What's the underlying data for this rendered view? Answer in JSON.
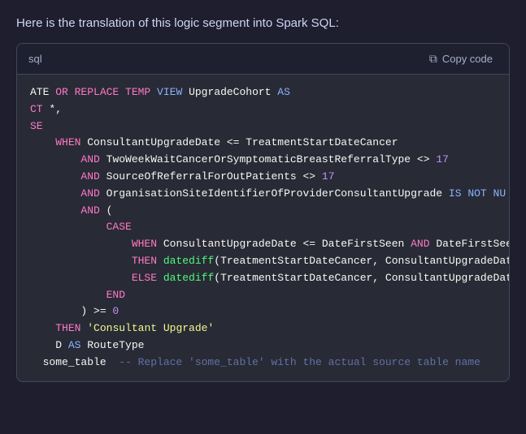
{
  "intro": {
    "text": "Here is the translation of this logic segment into Spark SQL:"
  },
  "code_header": {
    "lang": "sql",
    "copy_label": "Copy code"
  },
  "code_lines": [
    "ATE OR REPLACE TEMP VIEW UpgradeCohort AS",
    "CT *,",
    "SE",
    "    WHEN ConsultantUpgradeDate <= TreatmentStartDateCancer",
    "        AND TwoWeekWaitCancerOrSymptomaticBreastReferralType <> 17",
    "        AND SourceOfReferralForOutPatients <> 17",
    "        AND OrganisationSiteIdentifierOfProviderConsultantUpgrade IS NOT NU",
    "        AND (",
    "            CASE",
    "                WHEN ConsultantUpgradeDate <= DateFirstSeen AND DateFirstSeen I",
    "                THEN datediff(TreatmentStartDateCancer, ConsultantUpgradeDate)",
    "                ELSE datediff(TreatmentStartDateCancer, ConsultantUpgradeDate)",
    "            END",
    "        ) >= 0",
    "    THEN 'Consultant Upgrade'",
    "    D AS RouteType",
    "  some_table  -- Replace 'some_table' with the actual source table name"
  ]
}
